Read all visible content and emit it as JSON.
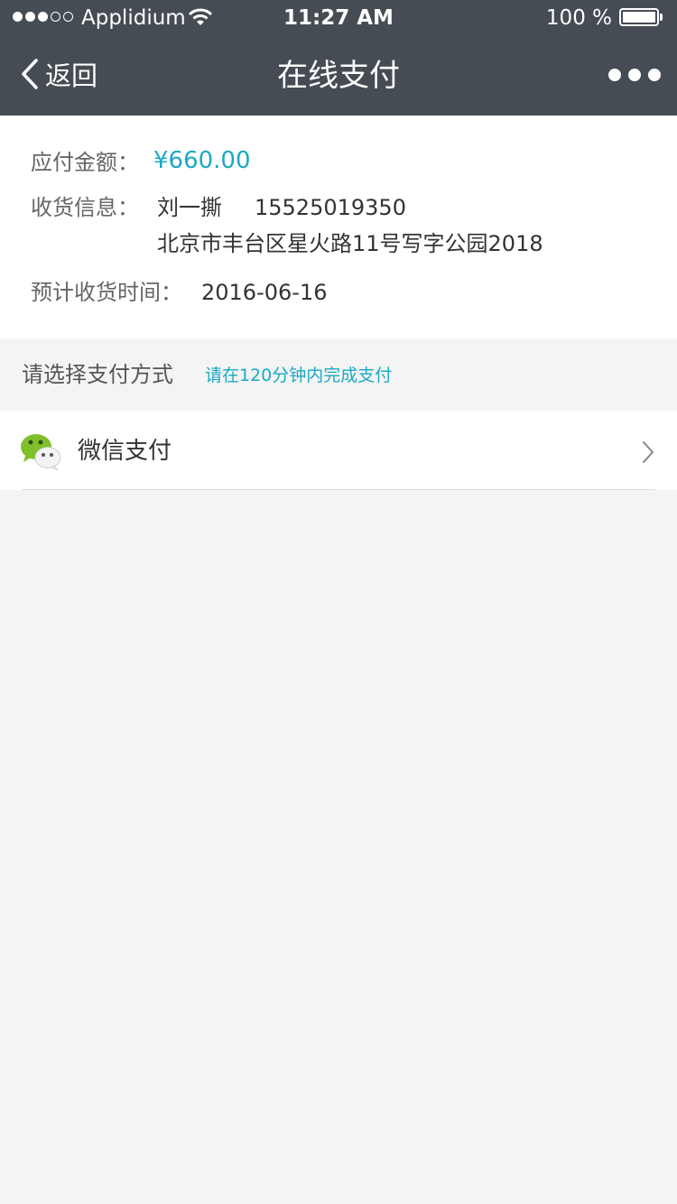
{
  "status_bar": {
    "carrier": "Applidium",
    "time": "11:27 AM",
    "battery": "100 %",
    "signal_strength": 3,
    "signal_max": 5,
    "battery_level": 1.0
  },
  "nav": {
    "back_label": "返回",
    "title": "在线支付"
  },
  "order": {
    "amount_label": "应付金额：",
    "amount_value": "¥660.00",
    "shipping_label": "收货信息：",
    "recipient_name": "刘一撕",
    "recipient_phone": "15525019350",
    "address": "北京市丰台区星火路11号写字公园2018",
    "delivery_label": "预计收货时间：",
    "delivery_date": "2016-06-16"
  },
  "payment": {
    "section_title": "请选择支付方式",
    "time_limit_note": "请在120分钟内完成支付",
    "methods": [
      {
        "label": "微信支付",
        "icon": "wechat-icon"
      }
    ]
  },
  "colors": {
    "header_bg": "#454c54",
    "accent": "#1aa9c4",
    "page_bg": "#f4f4f4",
    "wechat_green": "#7fbf2a"
  }
}
